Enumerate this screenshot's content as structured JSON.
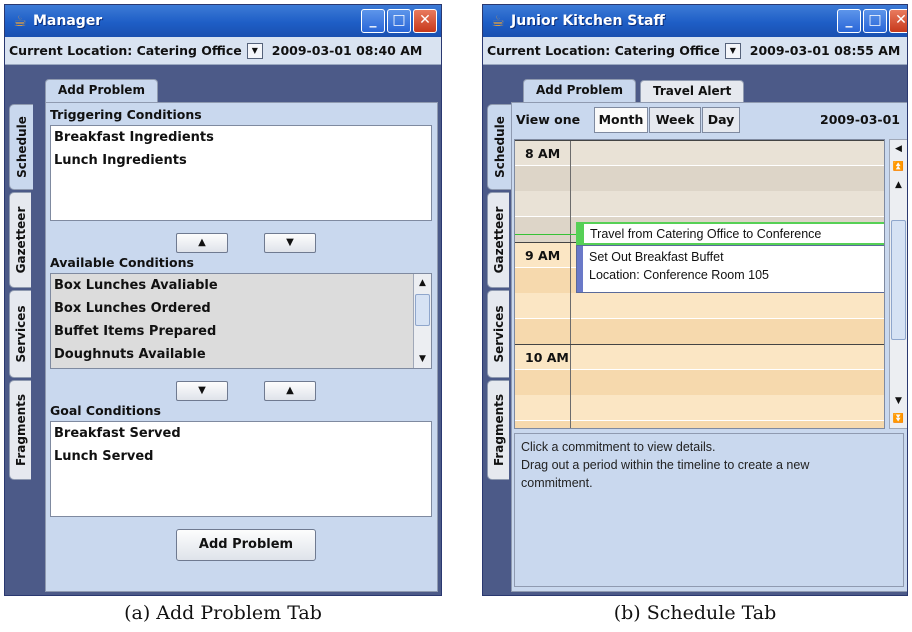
{
  "figures": [
    {
      "caption": "(a) Add Problem Tab",
      "window": {
        "title": "Manager",
        "location_label": "Current Location: Catering Office",
        "datetime": "2009-03-01 08:40 AM",
        "side_tabs": [
          "Schedule",
          "Gazetteer",
          "Services",
          "Fragments"
        ],
        "top_tabs": [
          "Add Problem"
        ],
        "triggering": {
          "label": "Triggering Conditions",
          "items": [
            "Breakfast Ingredients",
            "Lunch Ingredients"
          ]
        },
        "available": {
          "label": "Available Conditions",
          "items": [
            "Box Lunches Avaliable",
            "Box Lunches Ordered",
            "Buffet Items Prepared",
            "Doughnuts Available"
          ]
        },
        "goal": {
          "label": "Goal Conditions",
          "items": [
            "Breakfast Served",
            "Lunch Served"
          ]
        },
        "add_button": "Add Problem"
      }
    },
    {
      "caption": "(b) Schedule Tab",
      "window": {
        "title": "Junior Kitchen Staff",
        "location_label": "Current Location: Catering Office",
        "datetime": "2009-03-01 08:55 AM",
        "side_tabs": [
          "Schedule",
          "Gazetteer",
          "Services",
          "Fragments"
        ],
        "top_tabs": [
          "Add Problem",
          "Travel Alert"
        ],
        "view_label": "View one",
        "view_buttons": [
          "Month",
          "Week",
          "Day"
        ],
        "view_date": "2009-03-01",
        "hours": [
          "8 AM",
          "9 AM",
          "10 AM"
        ],
        "events": [
          {
            "lines": [
              "Travel from Catering Office to Conference"
            ]
          },
          {
            "lines": [
              "Set Out Breakfast Buffet",
              "Location: Conference Room 105"
            ]
          }
        ],
        "details_text": [
          "Click a commitment to view details.",
          "Drag out a period within the timeline to create a new",
          "commitment."
        ]
      }
    }
  ]
}
